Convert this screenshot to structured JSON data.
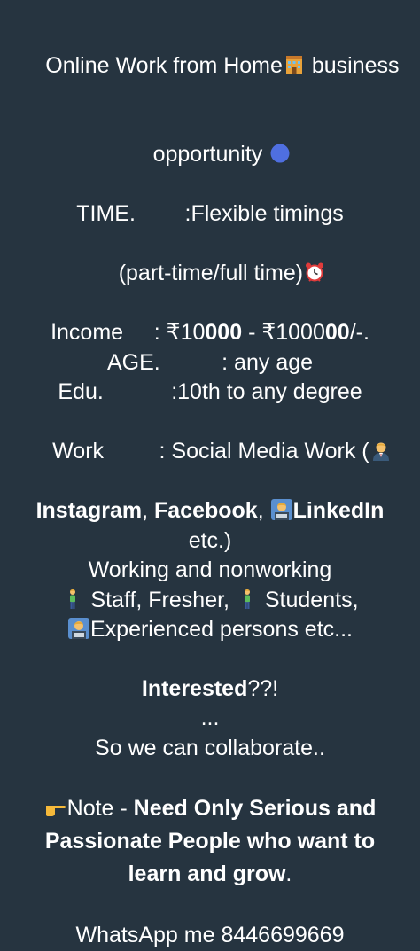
{
  "lines": {
    "l1": "Online Work from Home",
    "l1b": " business",
    "l2": "opportunity ",
    "l3": "TIME.        :Flexible timings",
    "l4": "(part-time/full time)",
    "l5a": "Income     : ₹10",
    "l5b": "000",
    "l5c": " - ₹1000",
    "l5d": "00",
    "l5e": "/-.",
    "l6": "AGE.          : any age",
    "l7": "Edu.           :10th to any degree",
    "l8": "Work         : Social Media Work (",
    "l9a": "Instagram",
    "l9b": ", ",
    "l9c": "Facebook",
    "l9d": ", ",
    "l9e": "LinkedIn",
    "l10": "etc.)",
    "l11": "Working and nonworking",
    "l12a": " Staff, Fresher, ",
    "l12b": " Students,",
    "l13": "Experienced persons etc...",
    "l14a": "Interested",
    "l14b": "??!",
    "l15": "...",
    "l16": "So we can collaborate..",
    "l17a": "Note - ",
    "l17b": "Need Only Serious and",
    "l18": "Passionate People who want to",
    "l19a": "learn and grow",
    "l19b": ".",
    "l20": "WhatsApp me 8446699669"
  },
  "icons": {
    "house": "office-building-icon",
    "circle": "blue-circle-icon",
    "clock": "alarm-clock-icon",
    "office_worker": "office-worker-icon",
    "technologist": "technologist-icon",
    "man_standing": "man-standing-icon",
    "pointing": "pointing-right-icon"
  },
  "colors": {
    "background": "#263440",
    "text": "#ffffff",
    "blue_circle": "#4f6fe0"
  }
}
